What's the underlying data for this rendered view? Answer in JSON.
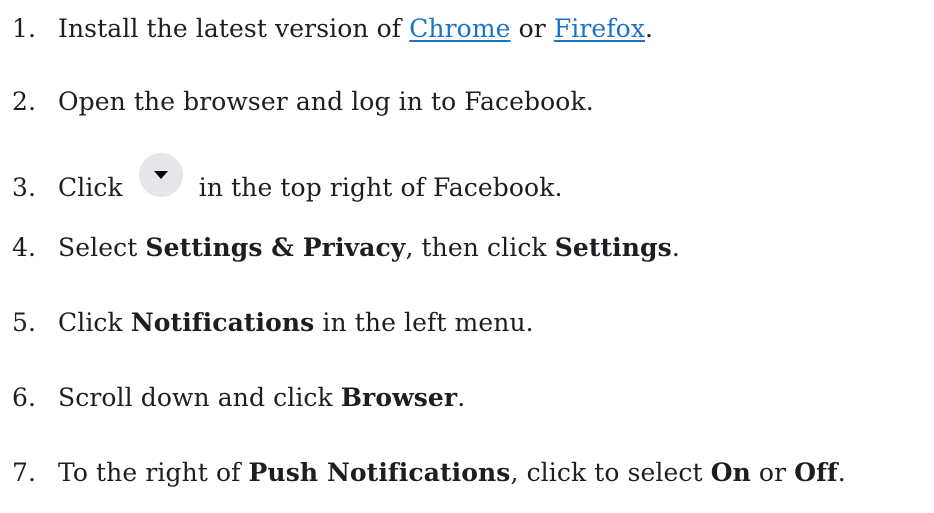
{
  "steps": [
    {
      "number": "1.",
      "text_before": "Install the latest version of ",
      "link_chrome": "Chrome",
      "text_mid": " or ",
      "link_firefox": "Firefox",
      "text_after": "."
    },
    {
      "number": "2.",
      "text": "Open the browser and log in to Facebook."
    },
    {
      "number": "3.",
      "text_before": "Click",
      "icon": "account-menu-dropdown-icon",
      "text_after": "in the top right of Facebook."
    },
    {
      "number": "4.",
      "text_before": "Select ",
      "bold1": "Settings & Privacy",
      "text_mid": ", then click ",
      "bold2": "Settings",
      "text_after": "."
    },
    {
      "number": "5.",
      "text_before": "Click ",
      "bold1": "Notifications",
      "text_after": " in the left menu."
    },
    {
      "number": "6.",
      "text_before": "Scroll down and click ",
      "bold1": "Browser",
      "text_after": "."
    },
    {
      "number": "7.",
      "text_before": "To the right of ",
      "bold1": "Push Notifications",
      "text_mid": ", click to select ",
      "bold2": "On",
      "text_mid2": " or ",
      "bold3": "Off",
      "text_after": "."
    }
  ],
  "colors": {
    "text": "#1c1e21",
    "link": "#1a73c8",
    "icon_bg": "#e4e6eb",
    "icon_fg": "#050505"
  }
}
